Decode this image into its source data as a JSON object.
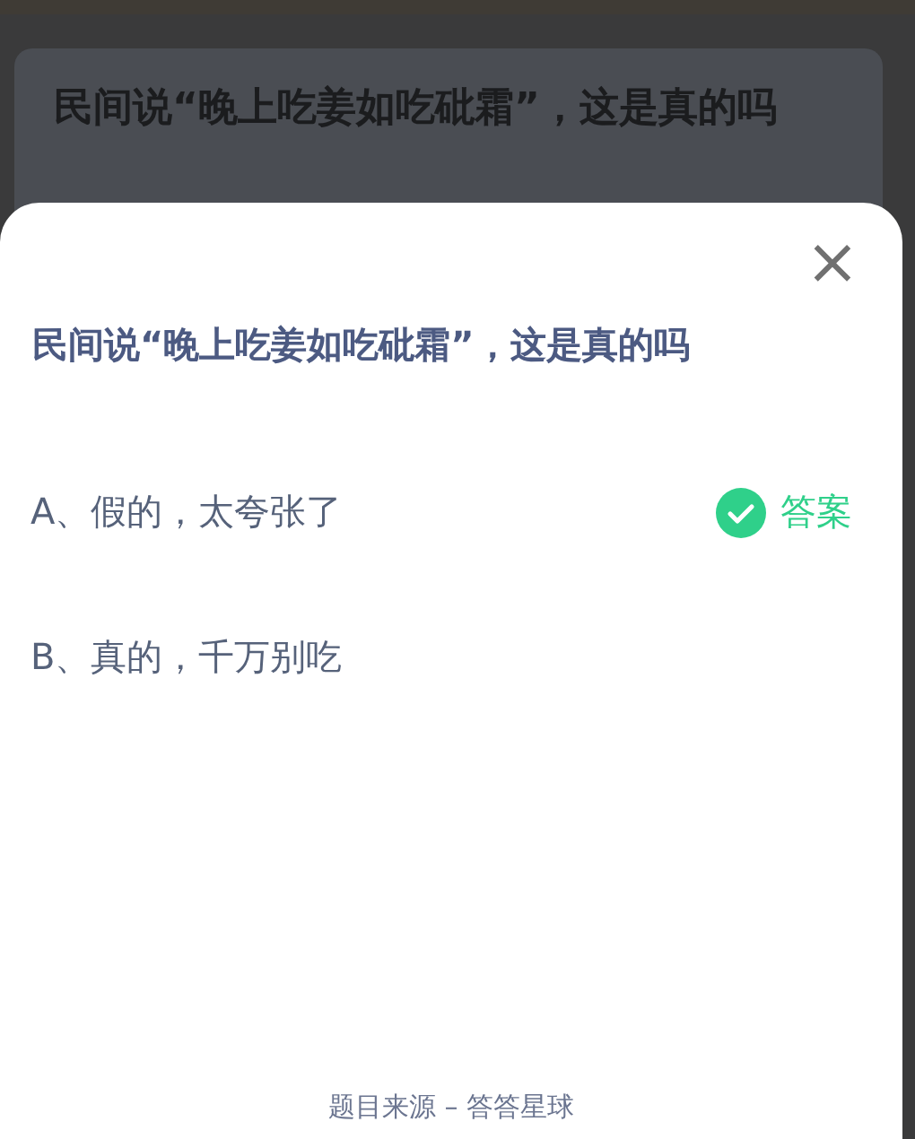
{
  "background_card": {
    "title": "民间说“晚上吃姜如吃砒霜”，这是真的吗"
  },
  "sheet": {
    "close": "×",
    "question": "民间说“晚上吃姜如吃砒霜”，这是真的吗",
    "answer_label": "答案",
    "options": [
      {
        "text": "A、假的，太夸张了",
        "correct": true
      },
      {
        "text": "B、真的，千万别吃",
        "correct": false
      }
    ],
    "footer": "题目来源 – 答答星球"
  }
}
